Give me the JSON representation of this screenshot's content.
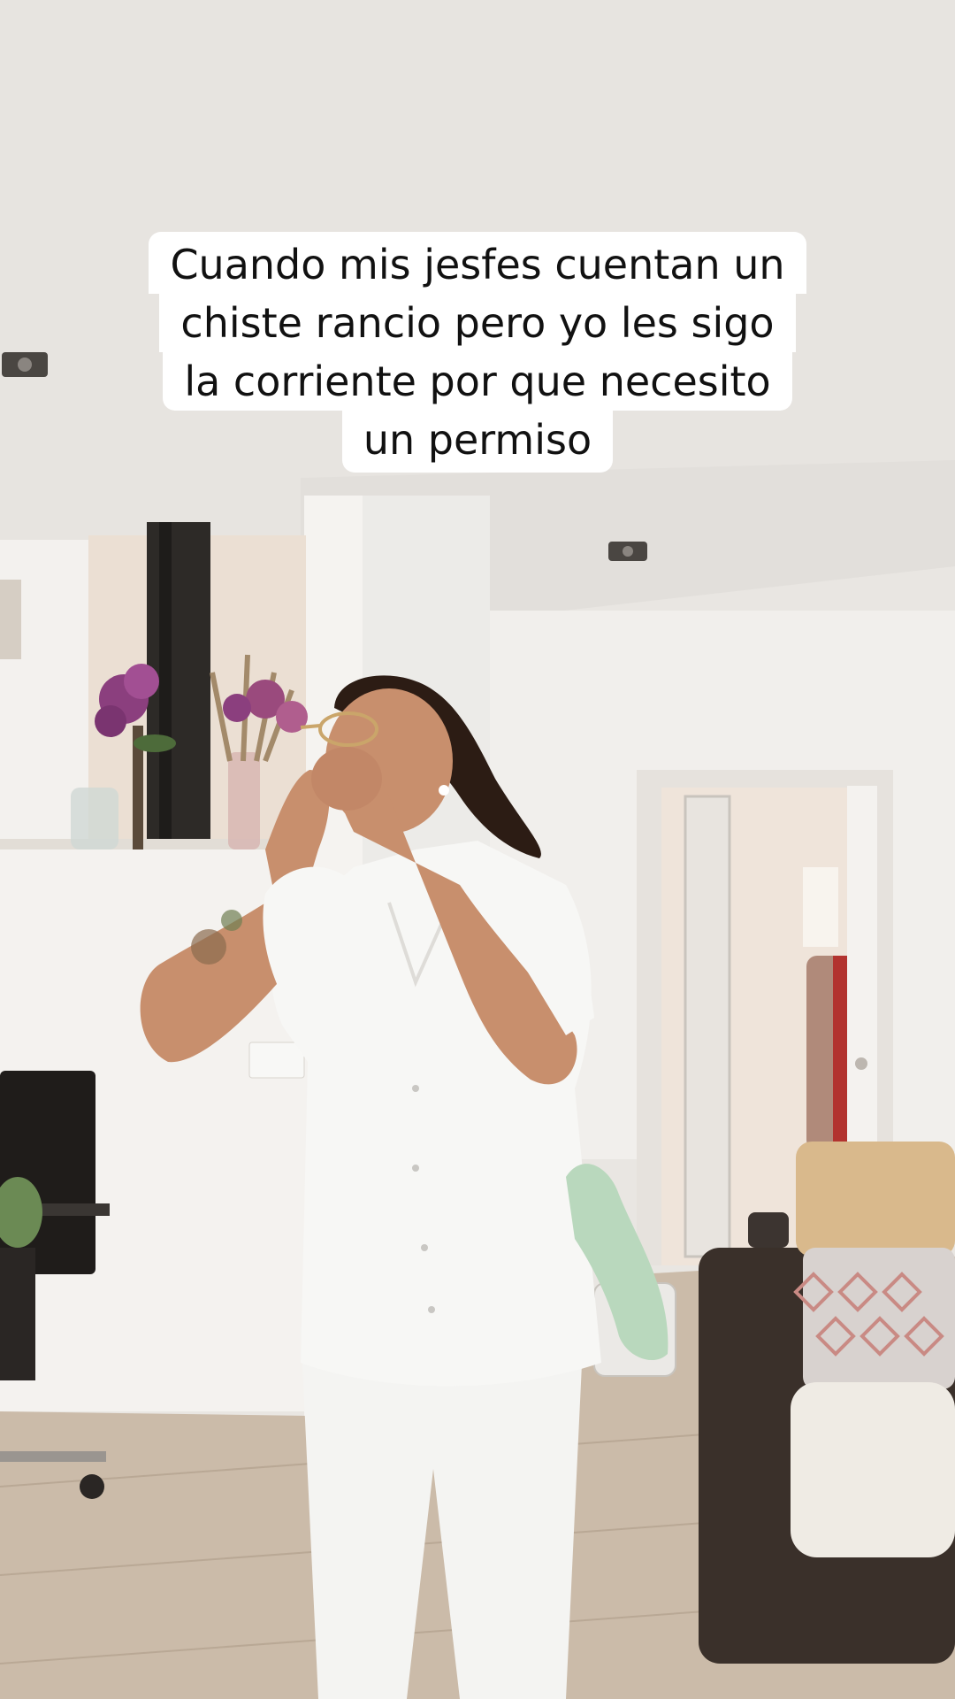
{
  "caption": {
    "lines": [
      "Cuando mis jesfes cuentan un",
      "chiste rancio pero yo les sigo",
      "la corriente por que necesito",
      "un permiso"
    ]
  },
  "colors": {
    "ceiling": "#e6e3df",
    "wall": "#f1efec",
    "floor": "#c8b8a6",
    "uniform": "#f7f7f5",
    "skin": "#c88f6d",
    "hair": "#2c1c14",
    "sofa": "#3a302a",
    "cushion_tan": "#d9b98c",
    "towel": "#b9d8bd",
    "flowers": "#8b3f7e"
  }
}
